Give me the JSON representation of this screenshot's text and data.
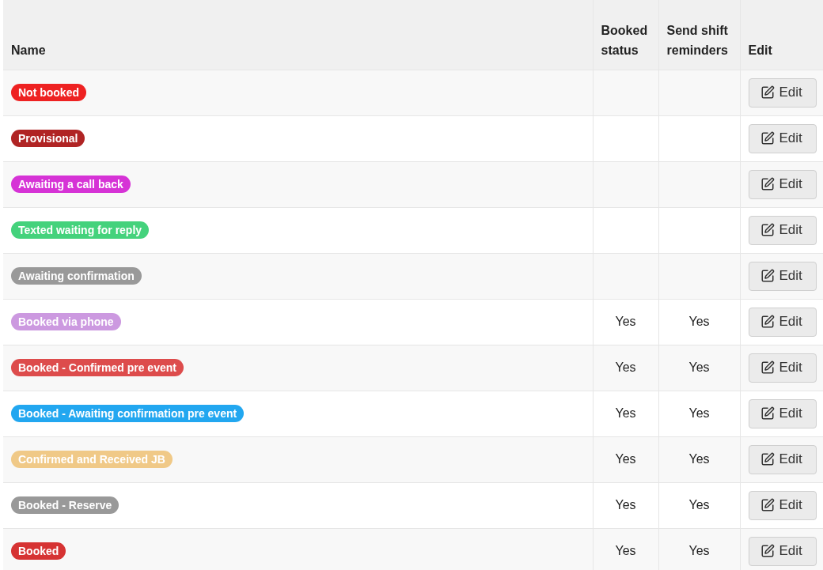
{
  "table": {
    "columns": [
      {
        "label": "Name"
      },
      {
        "label": "Booked status"
      },
      {
        "label": "Send shift reminders"
      },
      {
        "label": "Edit"
      }
    ],
    "rows": [
      {
        "name": "Not booked",
        "color": "#ee2222",
        "booked_status": "",
        "send_reminders": "",
        "edit": "Edit"
      },
      {
        "name": "Provisional",
        "color": "#b02424",
        "booked_status": "",
        "send_reminders": "",
        "edit": "Edit"
      },
      {
        "name": "Awaiting a call back",
        "color": "#d633d6",
        "booked_status": "",
        "send_reminders": "",
        "edit": "Edit"
      },
      {
        "name": "Texted waiting for reply",
        "color": "#44d27c",
        "booked_status": "",
        "send_reminders": "",
        "edit": "Edit"
      },
      {
        "name": "Awaiting confirmation",
        "color": "#999999",
        "booked_status": "",
        "send_reminders": "",
        "edit": "Edit"
      },
      {
        "name": "Booked via phone",
        "color": "#cc99e0",
        "booked_status": "Yes",
        "send_reminders": "Yes",
        "edit": "Edit"
      },
      {
        "name": "Booked - Confirmed pre event",
        "color": "#dd4c4c",
        "booked_status": "Yes",
        "send_reminders": "Yes",
        "edit": "Edit"
      },
      {
        "name": "Booked - Awaiting confirmation pre event",
        "color": "#22a7f0",
        "booked_status": "Yes",
        "send_reminders": "Yes",
        "edit": "Edit"
      },
      {
        "name": "Confirmed and Received JB",
        "color": "#f0c987",
        "booked_status": "Yes",
        "send_reminders": "Yes",
        "edit": "Edit"
      },
      {
        "name": "Booked - Reserve",
        "color": "#999999",
        "booked_status": "Yes",
        "send_reminders": "Yes",
        "edit": "Edit"
      },
      {
        "name": "Booked",
        "color": "#d63333",
        "booked_status": "Yes",
        "send_reminders": "Yes",
        "edit": "Edit"
      }
    ]
  }
}
